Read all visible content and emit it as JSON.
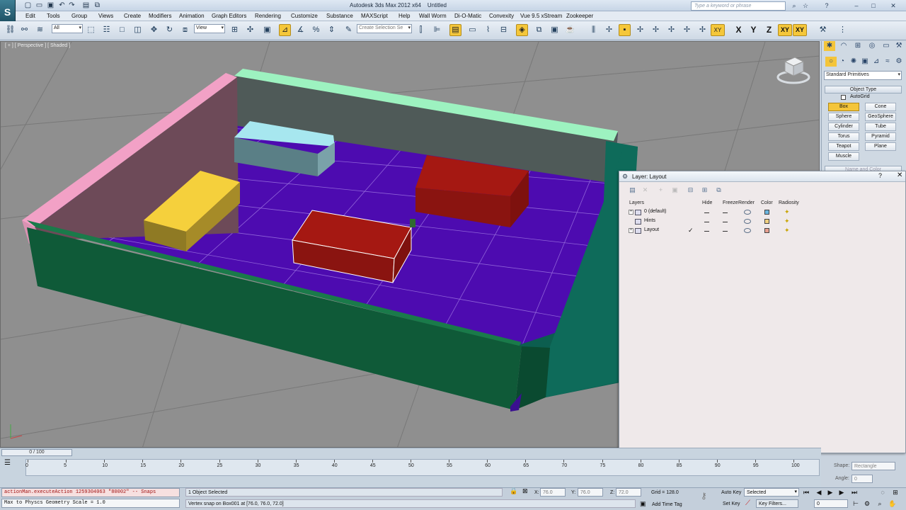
{
  "app": {
    "title": "Autodesk 3ds Max 2012 x64",
    "document": "Untitled",
    "search_placeholder": "Type a keyword or phrase"
  },
  "menubar": [
    "Edit",
    "Tools",
    "Group",
    "Views",
    "Create",
    "Modifiers",
    "Animation",
    "Graph Editors",
    "Rendering",
    "Customize",
    "Substance",
    "MAXScript",
    "Help",
    "Wall Worm",
    "Di-O-Matic",
    "Convexity",
    "Vue 9.5 xStream",
    "Zookeeper"
  ],
  "toolbar": {
    "selection_filter": "All",
    "ref_coord": "View",
    "named_selection": "Create Selection Se",
    "axis_labels": [
      "X",
      "Y",
      "Z",
      "XY",
      "XY"
    ]
  },
  "viewport": {
    "label": "[ + ] [ Perspective ] [ Shaded ]",
    "colors": {
      "floor": "#4d0bb0",
      "green_wall": "#0f5a38",
      "teal_wall": "#0e6b5a",
      "pink_wall": "#f2a1c6",
      "mint_top": "#9df2c0",
      "red_box": "#a51812",
      "yellow_box": "#f5d03c",
      "cyan_box": "#a7e7ef"
    }
  },
  "layer_window": {
    "title": "Layer: Layout",
    "columns": [
      "Layers",
      "Hide",
      "Freeze",
      "Render",
      "Color",
      "Radiosity"
    ],
    "layers": [
      {
        "name": "0 (default)",
        "color": "#6ab6e0",
        "active": false
      },
      {
        "name": "Hints",
        "color": "#f0d080",
        "active": false
      },
      {
        "name": "Layout",
        "color": "#e8a090",
        "active": true
      }
    ]
  },
  "command_panel": {
    "category": "Standard Primitives",
    "rollout_object_type": "Object Type",
    "autogrid": "AutoGrid",
    "buttons": [
      "Box",
      "Cone",
      "Sphere",
      "GeoSphere",
      "Cylinder",
      "Tube",
      "Torus",
      "Pyramid",
      "Teapot",
      "Plane",
      "Muscle"
    ],
    "active_button": "Box",
    "rollout_name_color": "Name and Color",
    "shape_label": "Shape:",
    "shape_value": "Rectangle",
    "angle_label": "Angle:",
    "angle_value": "0"
  },
  "timeline": {
    "slider": "0 / 100",
    "ticks": [
      "0",
      "5",
      "10",
      "15",
      "20",
      "25",
      "30",
      "35",
      "40",
      "45",
      "50",
      "55",
      "60",
      "65",
      "70",
      "75",
      "80",
      "85",
      "90",
      "95",
      "100"
    ]
  },
  "status": {
    "script_line1": "actionMan.executeAction 1259304063 \"80002\"  -- Snaps",
    "script_line2": "Max to Physcs Geometry Scale = 1.0",
    "selection": "1 Object Selected",
    "prompt": "Vertex snap on Box001 at [76.0, 76.0, 72.0]",
    "x_label": "X:",
    "x_value": "76.0",
    "y_label": "Y:",
    "y_value": "76.0",
    "z_label": "Z:",
    "z_value": "72.0",
    "grid": "Grid = 128.0",
    "add_time_tag": "Add Time Tag",
    "auto_key": "Auto Key",
    "set_key": "Set Key",
    "key_mode": "Selected",
    "key_filters": "Key Filters...",
    "frame": "0"
  }
}
